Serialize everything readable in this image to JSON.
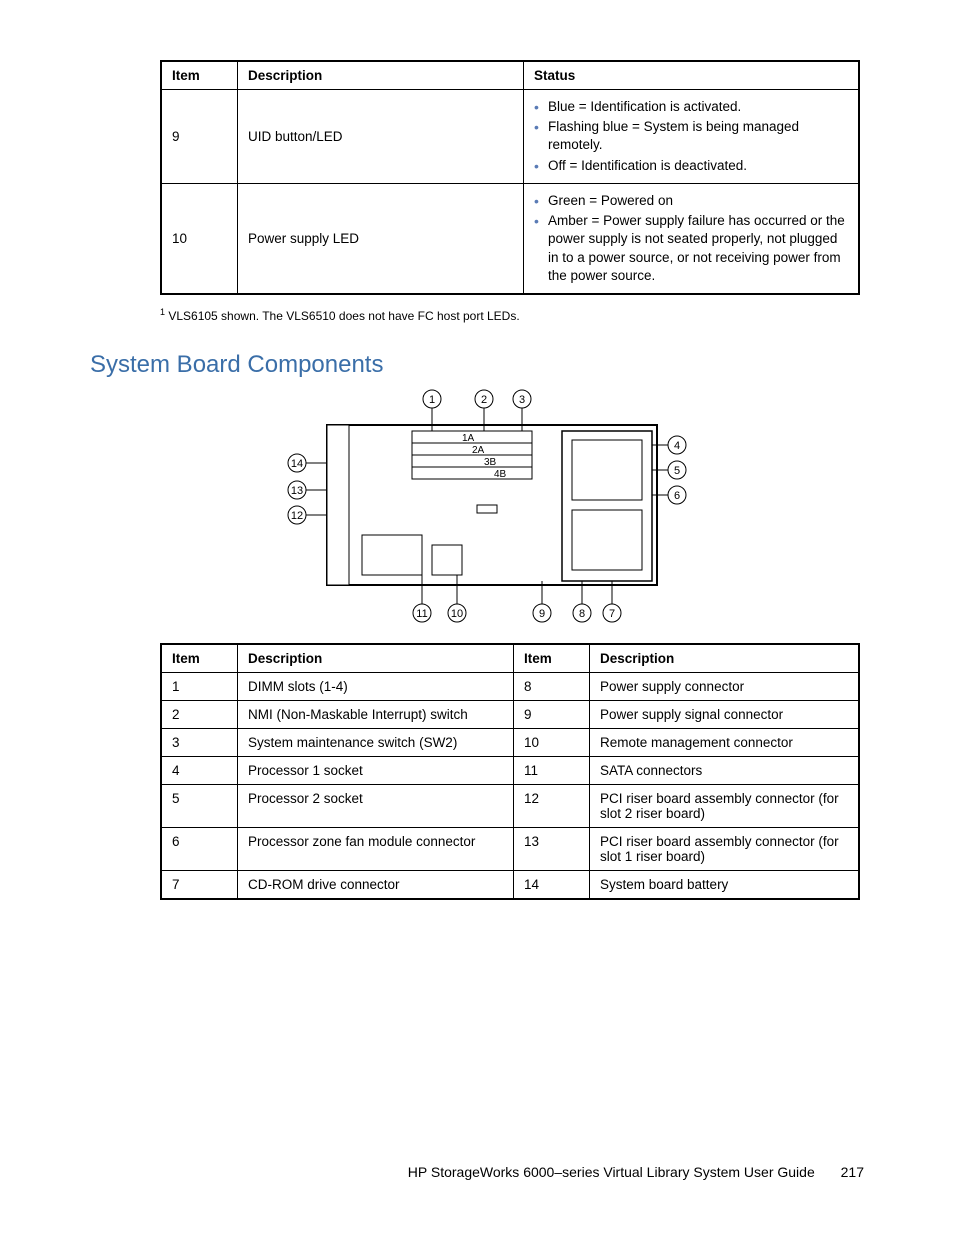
{
  "table1": {
    "headers": [
      "Item",
      "Description",
      "Status"
    ],
    "rows": [
      {
        "item": "9",
        "desc": "UID button/LED",
        "status": [
          "Blue = Identification is activated.",
          "Flashing blue = System is being managed remotely.",
          "Off = Identification is deactivated."
        ]
      },
      {
        "item": "10",
        "desc": "Power supply LED",
        "status": [
          "Green = Powered on",
          "Amber = Power supply failure has occurred or the power supply is not seated properly, not plugged in to a power source, or not receiving power from the power source."
        ]
      }
    ]
  },
  "footnote_sup": "1",
  "footnote_text": " VLS6105 shown. The VLS6510 does not have FC host port LEDs.",
  "section_heading": "System Board Components",
  "diagram_callouts": [
    "1",
    "2",
    "3",
    "4",
    "5",
    "6",
    "7",
    "8",
    "9",
    "10",
    "11",
    "12",
    "13",
    "14"
  ],
  "diagram_inner_labels": [
    "1A",
    "2A",
    "3B",
    "4B"
  ],
  "table2": {
    "headers": [
      "Item",
      "Description",
      "Item",
      "Description"
    ],
    "rows": [
      {
        "a": "1",
        "ad": "DIMM slots (1-4)",
        "b": "8",
        "bd": "Power supply connector"
      },
      {
        "a": "2",
        "ad": "NMI (Non-Maskable Interrupt) switch",
        "b": "9",
        "bd": "Power supply signal connector"
      },
      {
        "a": "3",
        "ad": "System maintenance switch (SW2)",
        "b": "10",
        "bd": "Remote management connector"
      },
      {
        "a": "4",
        "ad": "Processor 1 socket",
        "b": "11",
        "bd": "SATA connectors"
      },
      {
        "a": "5",
        "ad": "Processor 2 socket",
        "b": "12",
        "bd": "PCI riser board assembly connector (for slot 2 riser board)"
      },
      {
        "a": "6",
        "ad": "Processor zone fan module connector",
        "b": "13",
        "bd": "PCI riser board assembly connector (for slot 1 riser board)"
      },
      {
        "a": "7",
        "ad": "CD-ROM drive connector",
        "b": "14",
        "bd": "System board battery"
      }
    ]
  },
  "footer_title": "HP StorageWorks 6000–series Virtual Library System User Guide",
  "footer_page": "217"
}
